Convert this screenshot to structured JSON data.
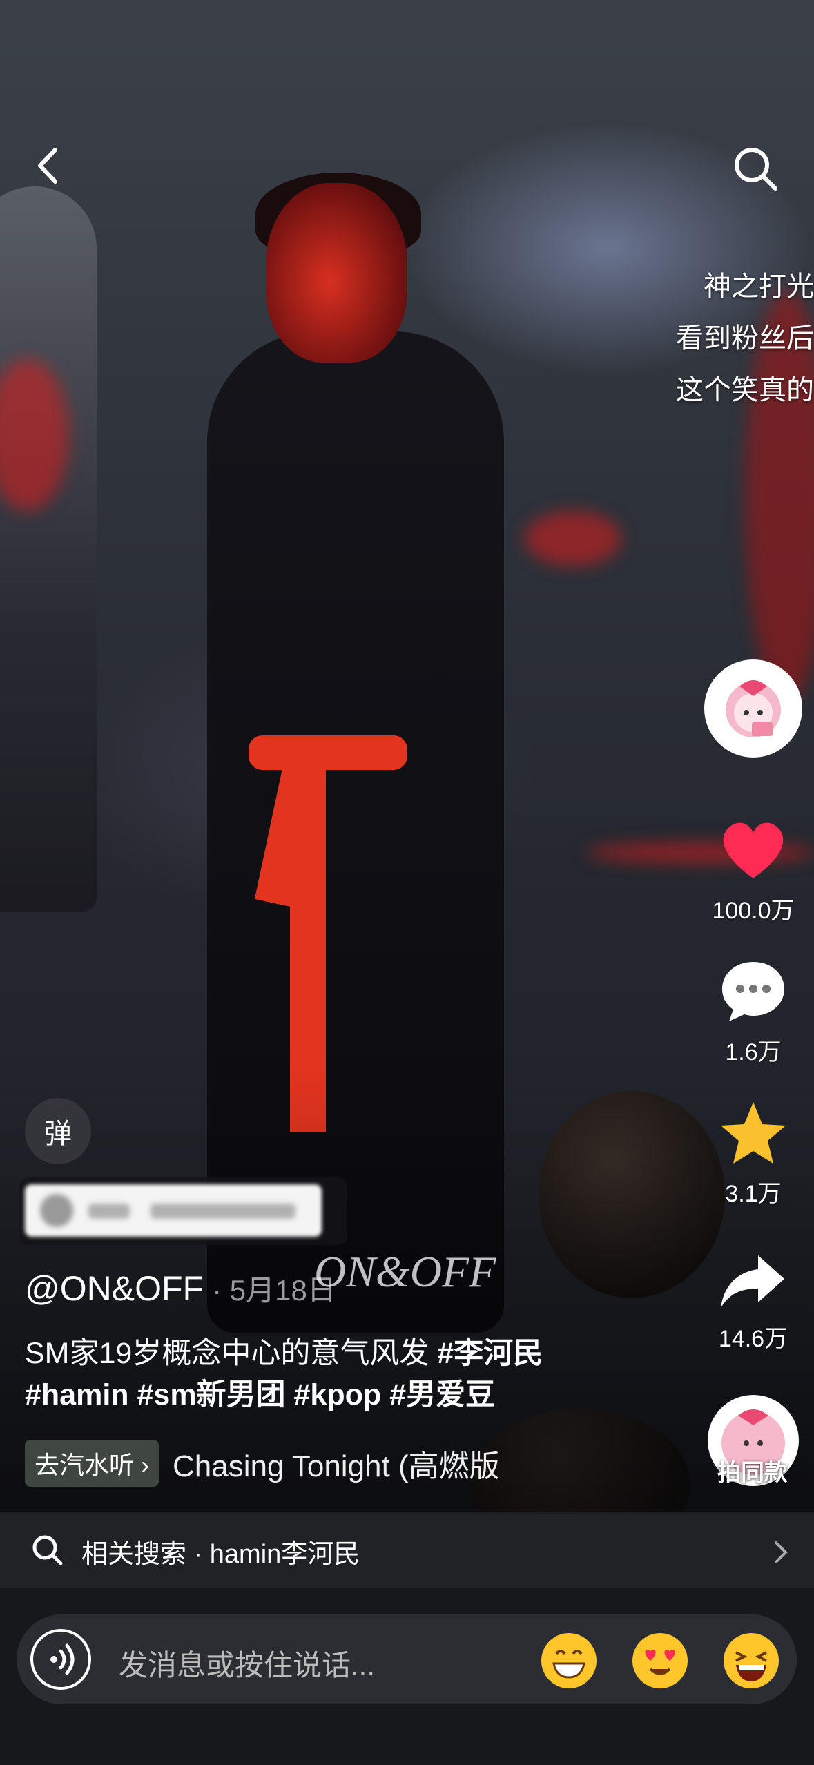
{
  "overlay_text": [
    "神之打光",
    "看到粉丝后",
    "这个笑真的"
  ],
  "actions": {
    "like_count": "100.0万",
    "comment_count": "1.6万",
    "favorite_count": "3.1万",
    "share_count": "14.6万",
    "shoot_same_label": "拍同款"
  },
  "danmaku_label": "弹",
  "post": {
    "author": "@ON&OFF",
    "date": "· 5月18日",
    "watermark": "ON&OFF",
    "caption_text": "SM家19岁概念中心的意气风发",
    "tags_line1": "#李河民",
    "tags_line2": "#hamin #sm新男团 #kpop #男爱豆"
  },
  "music": {
    "pill_label": "去汽水听 ›",
    "title": "Chasing Tonight (高燃版"
  },
  "related_search": {
    "label": "相关搜索 · hamin李河民"
  },
  "input": {
    "placeholder": "发消息或按住说话..."
  },
  "colors": {
    "like": "#fe2c55",
    "favorite": "#fbc02d",
    "emoji": "#ffc62b"
  },
  "icons": [
    "back-icon",
    "search-icon",
    "heart-icon",
    "comment-icon",
    "star-icon",
    "share-icon",
    "voice-icon",
    "chevron-right-icon"
  ]
}
